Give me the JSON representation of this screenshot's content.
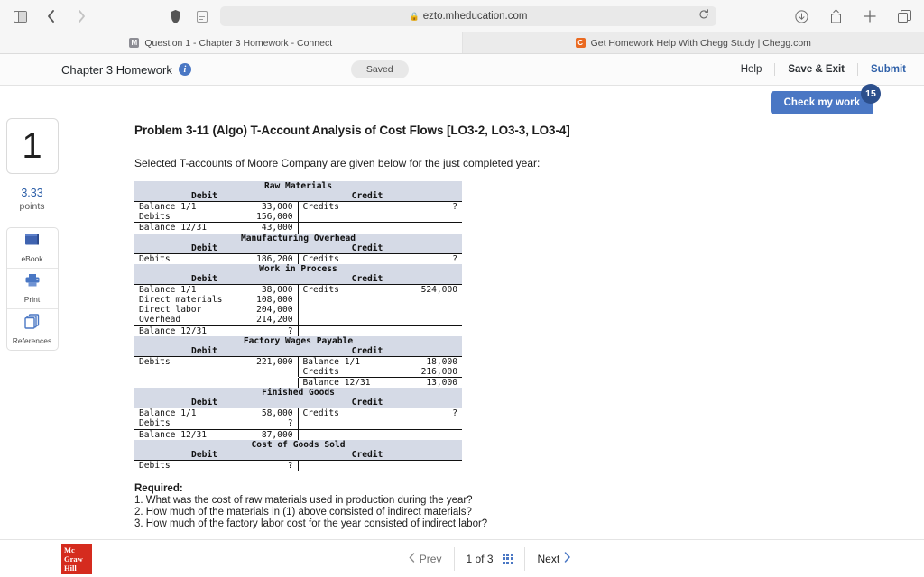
{
  "browser": {
    "url": "ezto.mheducation.com",
    "lock": "lock-icon",
    "tabs": [
      {
        "title": "Question 1 - Chapter 3 Homework - Connect",
        "favicon_letter": "M",
        "active": true
      },
      {
        "title": "Get Homework Help With Chegg Study | Chegg.com",
        "favicon_letter": "C",
        "active": false
      }
    ]
  },
  "header": {
    "title": "Chapter 3 Homework",
    "info": "i",
    "status": "Saved",
    "help": "Help",
    "save_exit": "Save & Exit",
    "submit": "Submit",
    "check_my_work": "Check my work",
    "check_badge": "15"
  },
  "left_rail": {
    "question_number": "1",
    "points_value": "3.33",
    "points_label": "points",
    "tools": [
      {
        "label": "eBook",
        "icon": "book-icon"
      },
      {
        "label": "Print",
        "icon": "printer-icon"
      },
      {
        "label": "References",
        "icon": "copy-icon"
      }
    ]
  },
  "problem": {
    "title": "Problem 3-11 (Algo) T-Account Analysis of Cost Flows [LO3-2, LO3-3, LO3-4]",
    "intro": "Selected T-accounts of Moore Company are given below for the just completed year:",
    "col_debit": "Debit",
    "col_credit": "Credit"
  },
  "taccounts": [
    {
      "name": "Raw Materials",
      "debit_rows": [
        {
          "label": "Balance 1/1",
          "amount": "33,000"
        },
        {
          "label": "Debits",
          "amount": "156,000"
        }
      ],
      "credit_rows": [
        {
          "label": "Credits",
          "amount": "?"
        }
      ],
      "debit_balance": {
        "label": "Balance 12/31",
        "amount": "43,000"
      },
      "credit_balance": null
    },
    {
      "name": "Manufacturing Overhead",
      "debit_rows": [
        {
          "label": "Debits",
          "amount": "186,200"
        }
      ],
      "credit_rows": [
        {
          "label": "Credits",
          "amount": "?"
        }
      ],
      "debit_balance": null,
      "credit_balance": null
    },
    {
      "name": "Work in Process",
      "debit_rows": [
        {
          "label": "Balance 1/1",
          "amount": "38,000"
        },
        {
          "label": "Direct materials",
          "amount": "108,000"
        },
        {
          "label": "Direct labor",
          "amount": "204,000"
        },
        {
          "label": "Overhead",
          "amount": "214,200"
        }
      ],
      "credit_rows": [
        {
          "label": "Credits",
          "amount": "524,000"
        }
      ],
      "debit_balance": {
        "label": "Balance 12/31",
        "amount": "?"
      },
      "credit_balance": null
    },
    {
      "name": "Factory Wages Payable",
      "debit_rows": [
        {
          "label": "Debits",
          "amount": "221,000"
        }
      ],
      "credit_rows": [
        {
          "label": "Balance 1/1",
          "amount": "18,000"
        },
        {
          "label": "Credits",
          "amount": "216,000"
        }
      ],
      "debit_balance": null,
      "credit_balance": {
        "label": "Balance 12/31",
        "amount": "13,000"
      }
    },
    {
      "name": "Finished Goods",
      "debit_rows": [
        {
          "label": "Balance 1/1",
          "amount": "58,000"
        },
        {
          "label": "Debits",
          "amount": "?"
        }
      ],
      "credit_rows": [
        {
          "label": "Credits",
          "amount": "?"
        }
      ],
      "debit_balance": {
        "label": "Balance 12/31",
        "amount": "87,000"
      },
      "credit_balance": null
    },
    {
      "name": "Cost of Goods Sold",
      "debit_rows": [
        {
          "label": "Debits",
          "amount": "?"
        }
      ],
      "credit_rows": [],
      "debit_balance": null,
      "credit_balance": null
    }
  ],
  "required": {
    "heading": "Required:",
    "items": [
      "1. What was the cost of raw materials used in production during the year?",
      "2. How much of the materials in (1) above consisted of indirect materials?",
      "3. How much of the factory labor cost for the year consisted of indirect labor?"
    ]
  },
  "footer": {
    "brand_line1": "Mc",
    "brand_line2": "Graw",
    "brand_line3": "Hill",
    "prev": "Prev",
    "page_info": "1 of 3",
    "next": "Next"
  }
}
